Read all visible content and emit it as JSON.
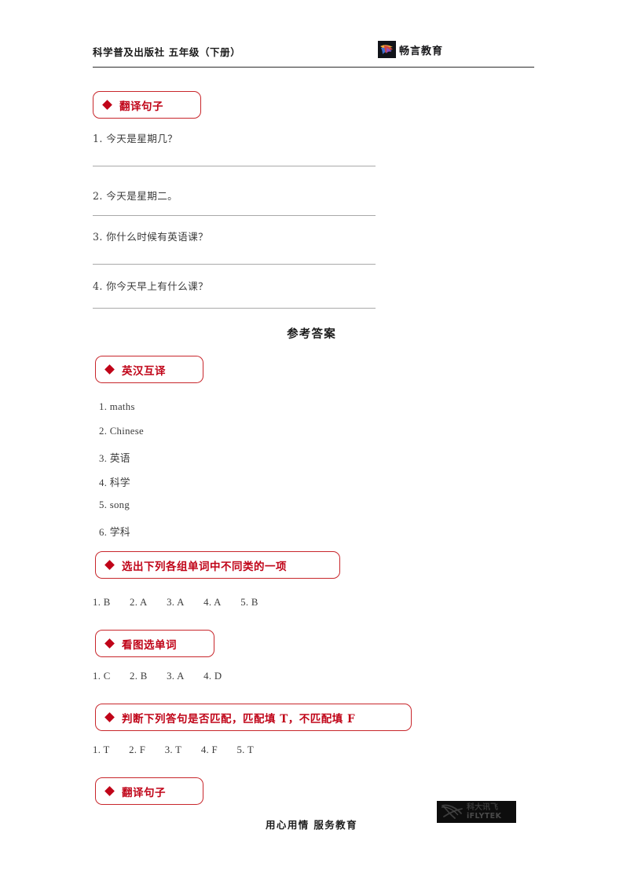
{
  "header": {
    "title": "科学普及出版社  五年级（下册）",
    "brand_name": "畅言教育",
    "brand_logo_icon": "bird-logo-icon"
  },
  "sections": [
    {
      "id": "translate-sentences-top",
      "pill_label": "翻译句子",
      "pill_width": 138,
      "questions": [
        "1.  今天是星期几？",
        "2.  今天是星期二。",
        "3.  你什么时候有英语课？",
        "4.  你今天早上有什么课？"
      ]
    }
  ],
  "answers_heading": "参考答案",
  "answer_sections": [
    {
      "id": "en-cn-translation",
      "pill_label": "英汉互译",
      "pill_width": 138,
      "items": [
        "1. maths",
        "2. Chinese",
        "3.  英语",
        "4.  科学",
        "5. song",
        "6.  学科"
      ]
    },
    {
      "id": "odd-one-out",
      "pill_label": "选出下列各组单词中不同类的一项",
      "pill_width": 312,
      "row": [
        "1. B",
        "2. A",
        "3. A",
        "4. A",
        "5. B"
      ]
    },
    {
      "id": "picture-word-choice",
      "pill_label": "看图选单词",
      "pill_width": 152,
      "row": [
        "1. C",
        "2. B",
        "3. A",
        "4. D"
      ]
    },
    {
      "id": "match-true-false",
      "pill_label": "判断下列答句是否匹配，匹配填 T，不匹配填 F",
      "pill_width": 403,
      "row": [
        "1. T",
        "2. F",
        "3. T",
        "4. F",
        "5. T"
      ]
    },
    {
      "id": "translate-sentences-bottom",
      "pill_label": "翻译句子",
      "pill_width": 138,
      "row": []
    }
  ],
  "footer": {
    "slogan": "用心用情   服务教育",
    "logo_cn": "科大讯飞",
    "logo_en": "iFLYTEK",
    "logo_icon": "iflytek-logo-icon"
  },
  "colors": {
    "accent_red": "#c00418",
    "pill_border": "#c8262b",
    "rule_gray": "#a9a9a9",
    "text": "#3b3b3b"
  }
}
